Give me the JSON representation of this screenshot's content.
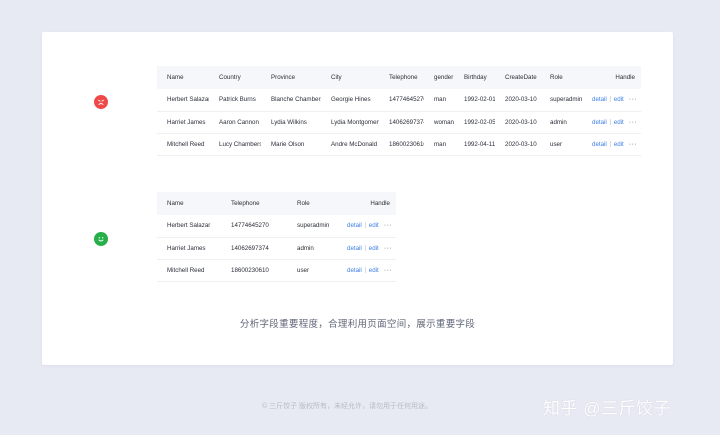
{
  "table_full": {
    "columns": [
      "Name",
      "Country",
      "Province",
      "City",
      "Telephone",
      "gender",
      "Birthday",
      "CreateDate",
      "Role",
      "Handle"
    ],
    "rows": [
      [
        "Herbert Salazar",
        "Patrick Burns",
        "Blanche Chambers",
        "Georgie Hines",
        "14774645270",
        "man",
        "1992-02-01",
        "2020-03-10",
        "superadmin"
      ],
      [
        "Harriet James",
        "Aaron Cannon",
        "Lydia Wilkins",
        "Lydia Montgomery",
        "14062697374",
        "woman",
        "1992-02-05",
        "2020-03-10",
        "admin"
      ],
      [
        "Mitchell Reed",
        "Lucy Chambers",
        "Marie Olson",
        "Andre McDonald",
        "18600230610",
        "man",
        "1992-04-11",
        "2020-03-10",
        "user"
      ]
    ]
  },
  "table_compact": {
    "columns": [
      "Name",
      "Telephone",
      "Role",
      "Handle"
    ],
    "rows": [
      [
        "Herbert Salazar",
        "14774645270",
        "superadmin"
      ],
      [
        "Harriet James",
        "14062697374",
        "admin"
      ],
      [
        "Mitchell Reed",
        "18600230610",
        "user"
      ]
    ]
  },
  "actions": {
    "detail": "detail",
    "edit": "edit",
    "more": "···"
  },
  "markers": {
    "bad": "sad-face-icon",
    "good": "smile-face-icon",
    "bad_color": "#ee4a4a",
    "good_color": "#27b04a"
  },
  "caption": "分析字段重要程度，合理利用页面空间，展示重要字段",
  "footer": "© 三斤饺子  版权所有，未经允许，请勿用于任何用途。",
  "watermark": "知乎 @三斤饺子",
  "colors": {
    "background": "#e8eaf3",
    "link": "#3f7fe6",
    "header_bg": "#f6f7fa"
  }
}
